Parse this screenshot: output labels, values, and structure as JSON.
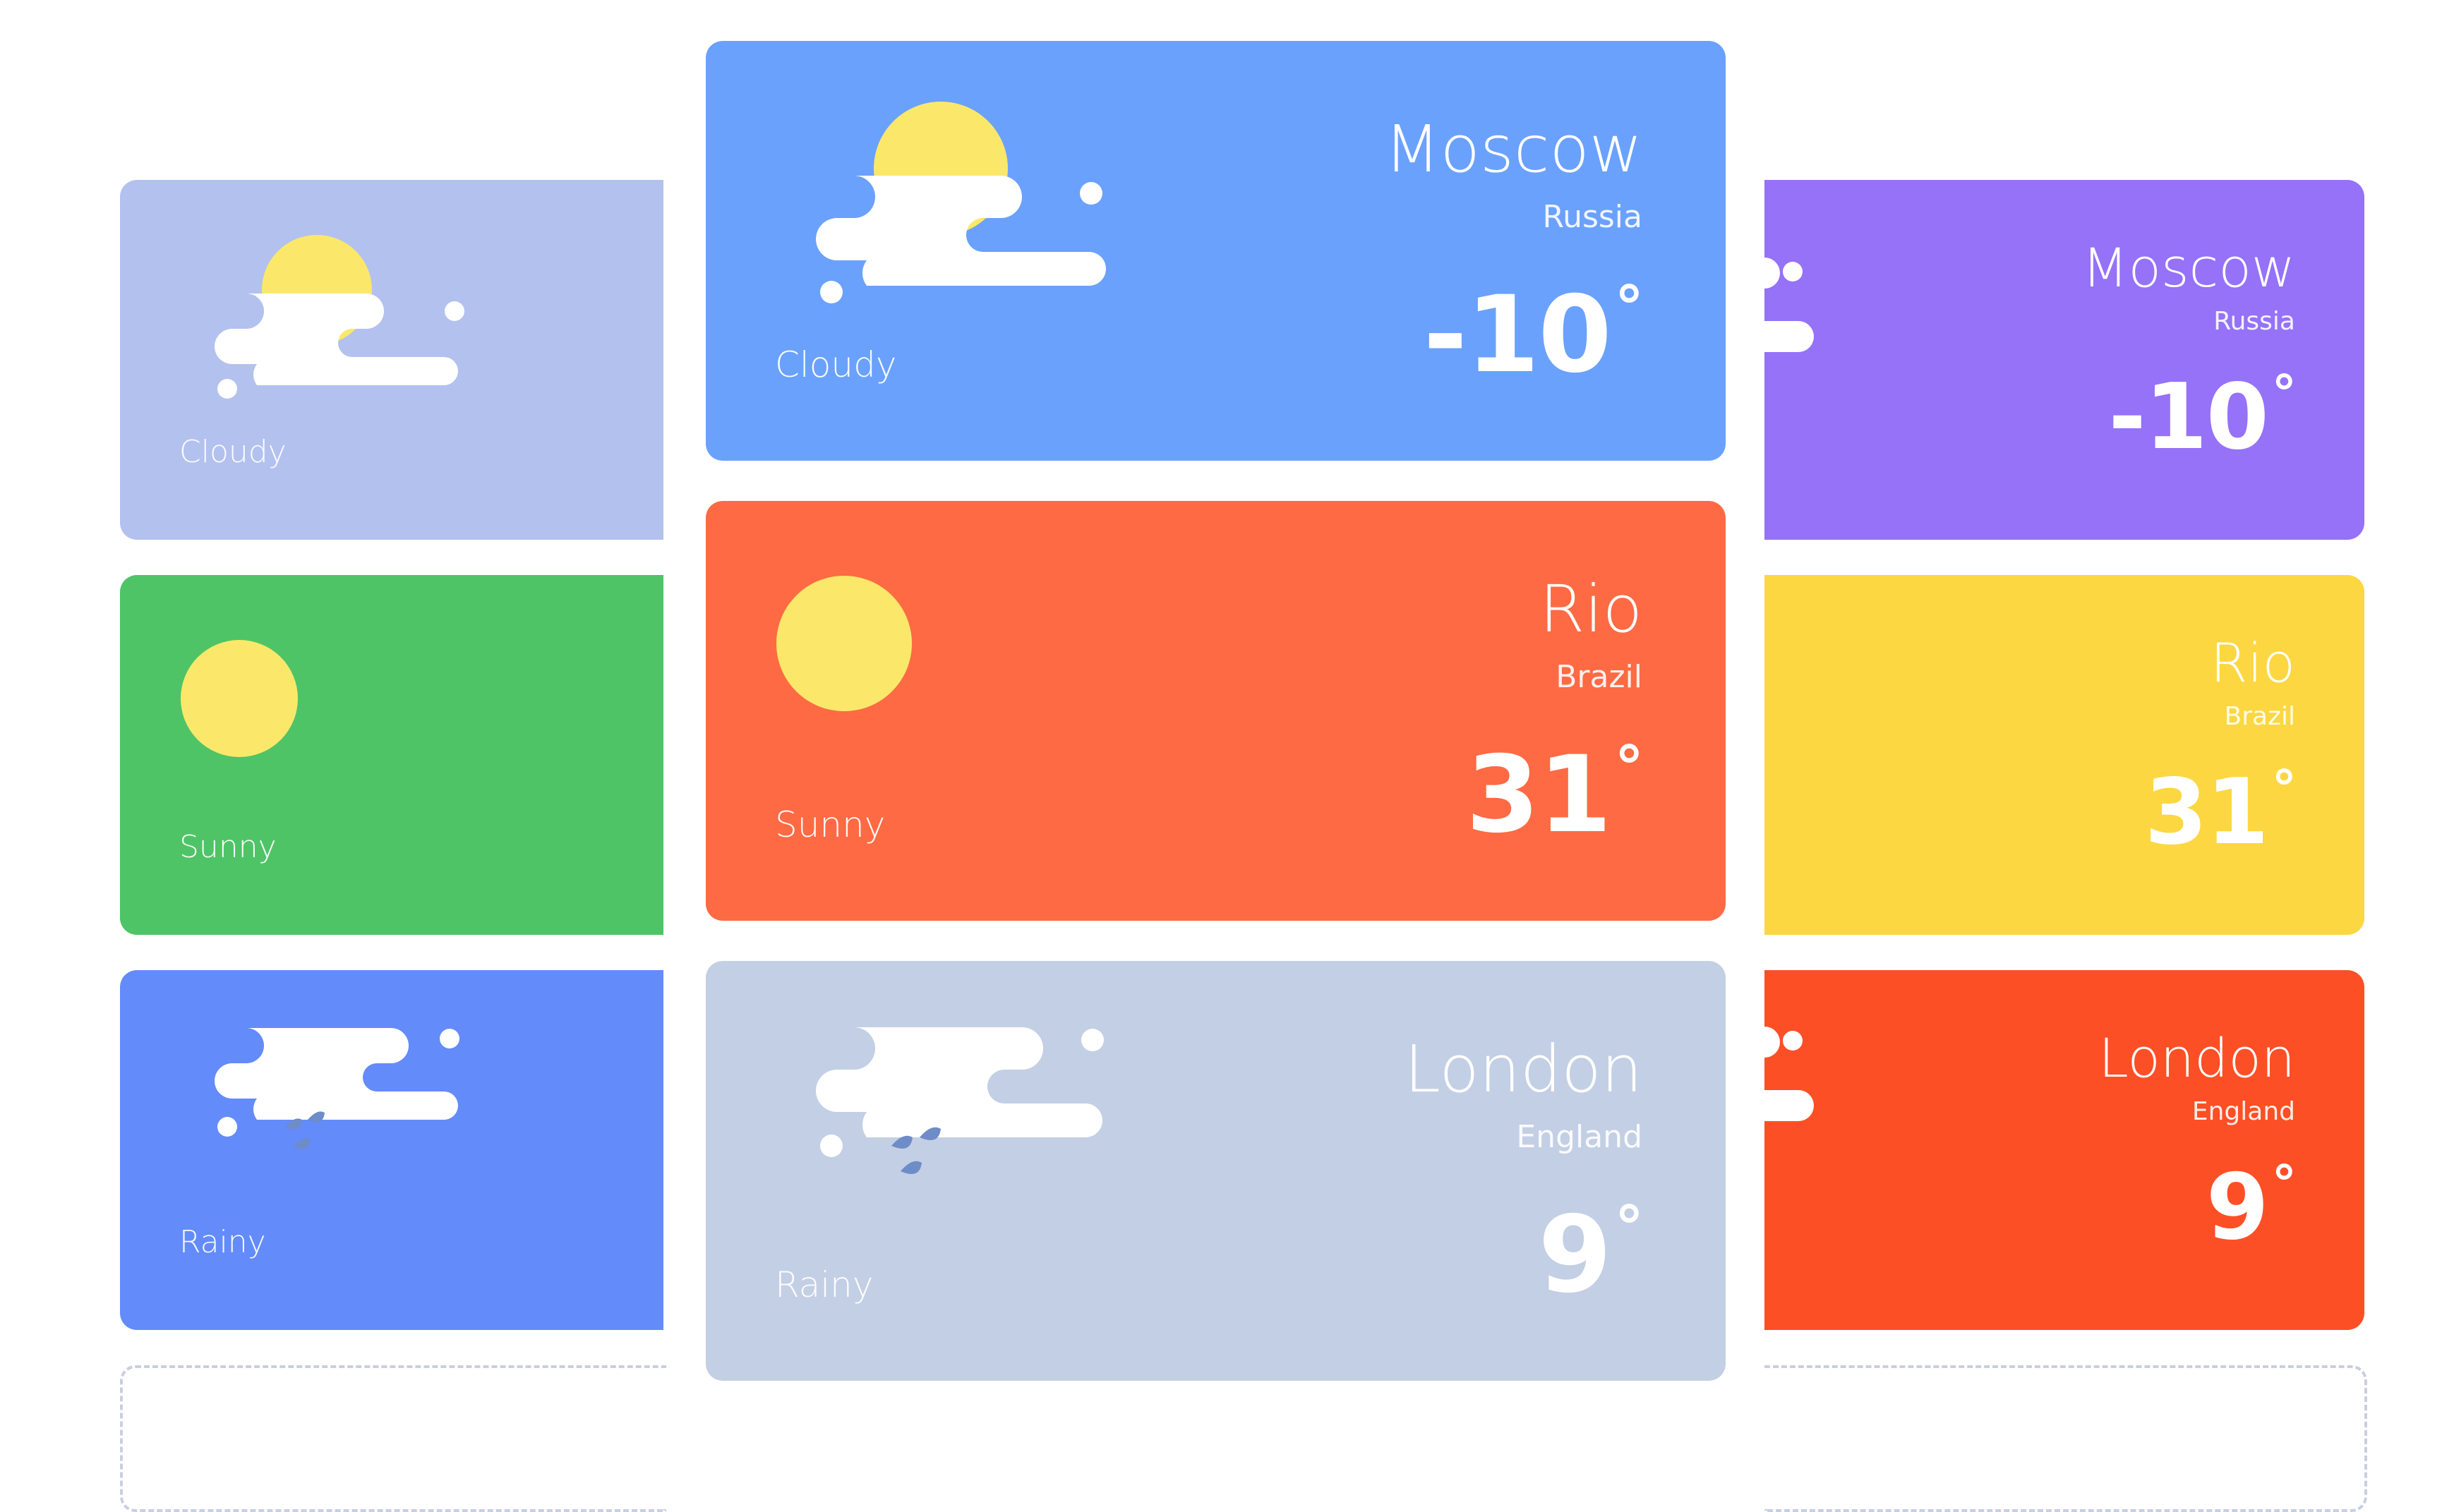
{
  "conditions": {
    "cloudy": "Cloudy",
    "sunny": "Sunny",
    "rainy": "Rainy"
  },
  "cities": {
    "moscow": {
      "city": "Moscow",
      "country": "Russia",
      "temp": "-10"
    },
    "rio": {
      "city": "Rio",
      "country": "Brazil",
      "temp": "31"
    },
    "london": {
      "city": "London",
      "country": "England",
      "temp": "9"
    }
  },
  "degree_symbol": "°",
  "colors": {
    "left_cloudy": "#b3c1ee",
    "left_sunny": "#4ec466",
    "left_rainy": "#638bfa",
    "center_cloudy": "#6aa1fd",
    "center_sunny": "#fe6a43",
    "center_rainy": "#c3cfe4",
    "right_cloudy": "#9572f8",
    "right_sunny": "#fcd741",
    "right_rainy": "#fd4f26",
    "sun": "#fbe86a",
    "rain_drop": "#6e8cc8"
  },
  "icons": {
    "cloudy": "sun-behind-cloud-icon",
    "sunny": "sun-icon",
    "rainy": "rain-cloud-icon"
  }
}
